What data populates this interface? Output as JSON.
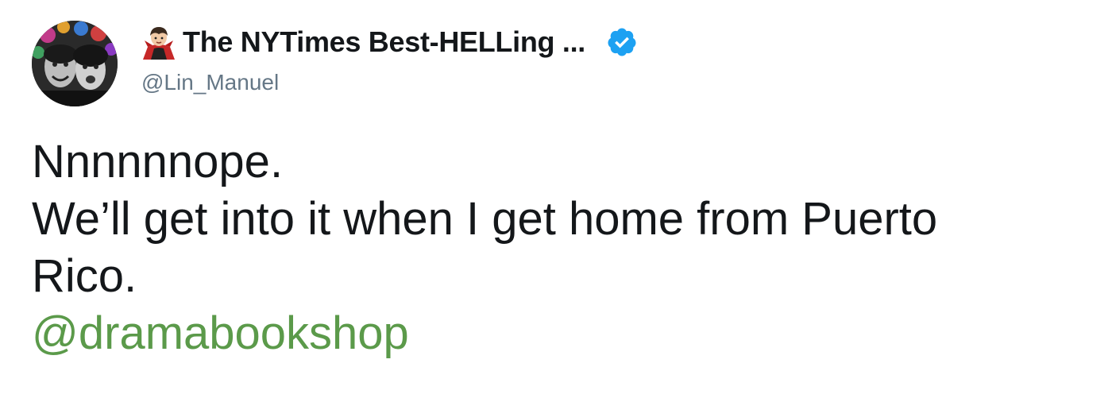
{
  "author": {
    "display_name": "The NYTimes Best-HELLing ...",
    "handle": "@Lin_Manuel",
    "avatar": "avatar-photo",
    "name_emoji": "vampire-emoji-icon",
    "verified_icon": "verified-badge-icon"
  },
  "tweet": {
    "lines": [
      "Nnnnnnope.",
      "We’ll get into it when I get home from Puerto",
      "Rico."
    ],
    "mention": "@dramabookshop"
  },
  "colors": {
    "text": "#14171a",
    "handle": "#657786",
    "mention": "#5b9a4a",
    "verified": "#1da1f2"
  }
}
